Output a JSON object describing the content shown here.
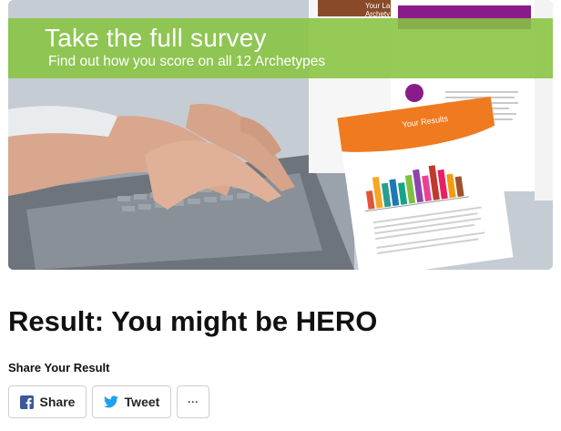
{
  "banner": {
    "title": "Take the full survey",
    "subtitle": "Find out how you score on all 12 Archetypes",
    "doc_top_label_1": "Your La",
    "doc_top_label_2": "Archety",
    "results_label": "Your Results",
    "colors": {
      "band": "#88c440",
      "orange": "#f07a1f",
      "purple": "#8a1c8a"
    }
  },
  "heading": "Result: You might be HERO",
  "share": {
    "title": "Share Your Result",
    "facebook_label": "Share",
    "twitter_label": "Tweet",
    "more_label": "···",
    "colors": {
      "facebook": "#3b5998",
      "twitter": "#1da1f2"
    }
  }
}
